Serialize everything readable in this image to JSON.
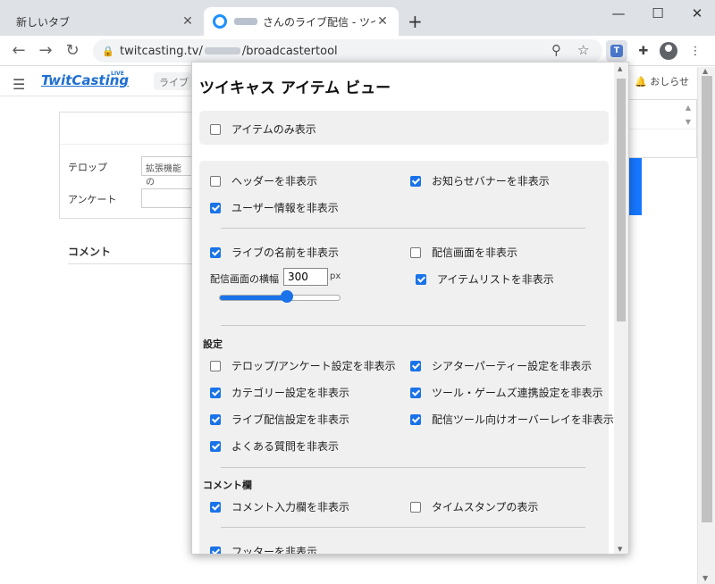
{
  "browser": {
    "tabs": [
      {
        "title": "新しいタブ",
        "active": false
      },
      {
        "title": "さんのライブ配信 - ツイキャス",
        "active": true
      }
    ],
    "new_tab_icon": "plus-icon",
    "window_controls": {
      "minimize": "—",
      "maximize": "☐",
      "close": "✕"
    },
    "url": {
      "host": "twitcasting.tv/",
      "path": "/broadcastertool"
    }
  },
  "page": {
    "logo": "TwitCasting",
    "logo_sup": "LIVE",
    "live_menu": "ライブ",
    "notifications": "おしらせ",
    "telop_label": "テロップ",
    "telop_value": "拡張機能の",
    "survey_label": "アンケート",
    "comment_label": "コメント"
  },
  "popup": {
    "title": "ツイキャス アイテム ビュー",
    "items_only": {
      "label": "アイテムのみ表示",
      "checked": false
    },
    "group1": [
      {
        "label": "ヘッダーを非表示",
        "checked": false
      },
      {
        "label": "お知らせバナーを非表示",
        "checked": true
      },
      {
        "label": "ユーザー情報を非表示",
        "checked": true
      }
    ],
    "group2": [
      {
        "label": "ライブの名前を非表示",
        "checked": true
      },
      {
        "label": "配信画面を非表示",
        "checked": false
      },
      {
        "label": "アイテムリストを非表示",
        "checked": true
      }
    ],
    "width": {
      "label": "配信画面の横幅",
      "value": "300",
      "unit": "px",
      "slider_fraction": 0.56
    },
    "settings_head": "設定",
    "settings": [
      {
        "label": "テロップ/アンケート設定を非表示",
        "checked": false
      },
      {
        "label": "シアターパーティー設定を非表示",
        "checked": true
      },
      {
        "label": "カテゴリー設定を非表示",
        "checked": true
      },
      {
        "label": "ツール・ゲームズ連携設定を非表示",
        "checked": true
      },
      {
        "label": "ライブ配信設定を非表示",
        "checked": true
      },
      {
        "label": "配信ツール向けオーバーレイを非表示",
        "checked": true
      },
      {
        "label": "よくある質問を非表示",
        "checked": true
      }
    ],
    "comments_head": "コメント欄",
    "comments": [
      {
        "label": "コメント入力欄を非表示",
        "checked": true
      },
      {
        "label": "タイムスタンプの表示",
        "checked": false
      }
    ],
    "footer": {
      "label": "フッターを非表示",
      "checked": true
    }
  },
  "colors": {
    "accent": "#1a73e8",
    "brand": "#1f6fd1",
    "panel": "#f0f0f0"
  }
}
